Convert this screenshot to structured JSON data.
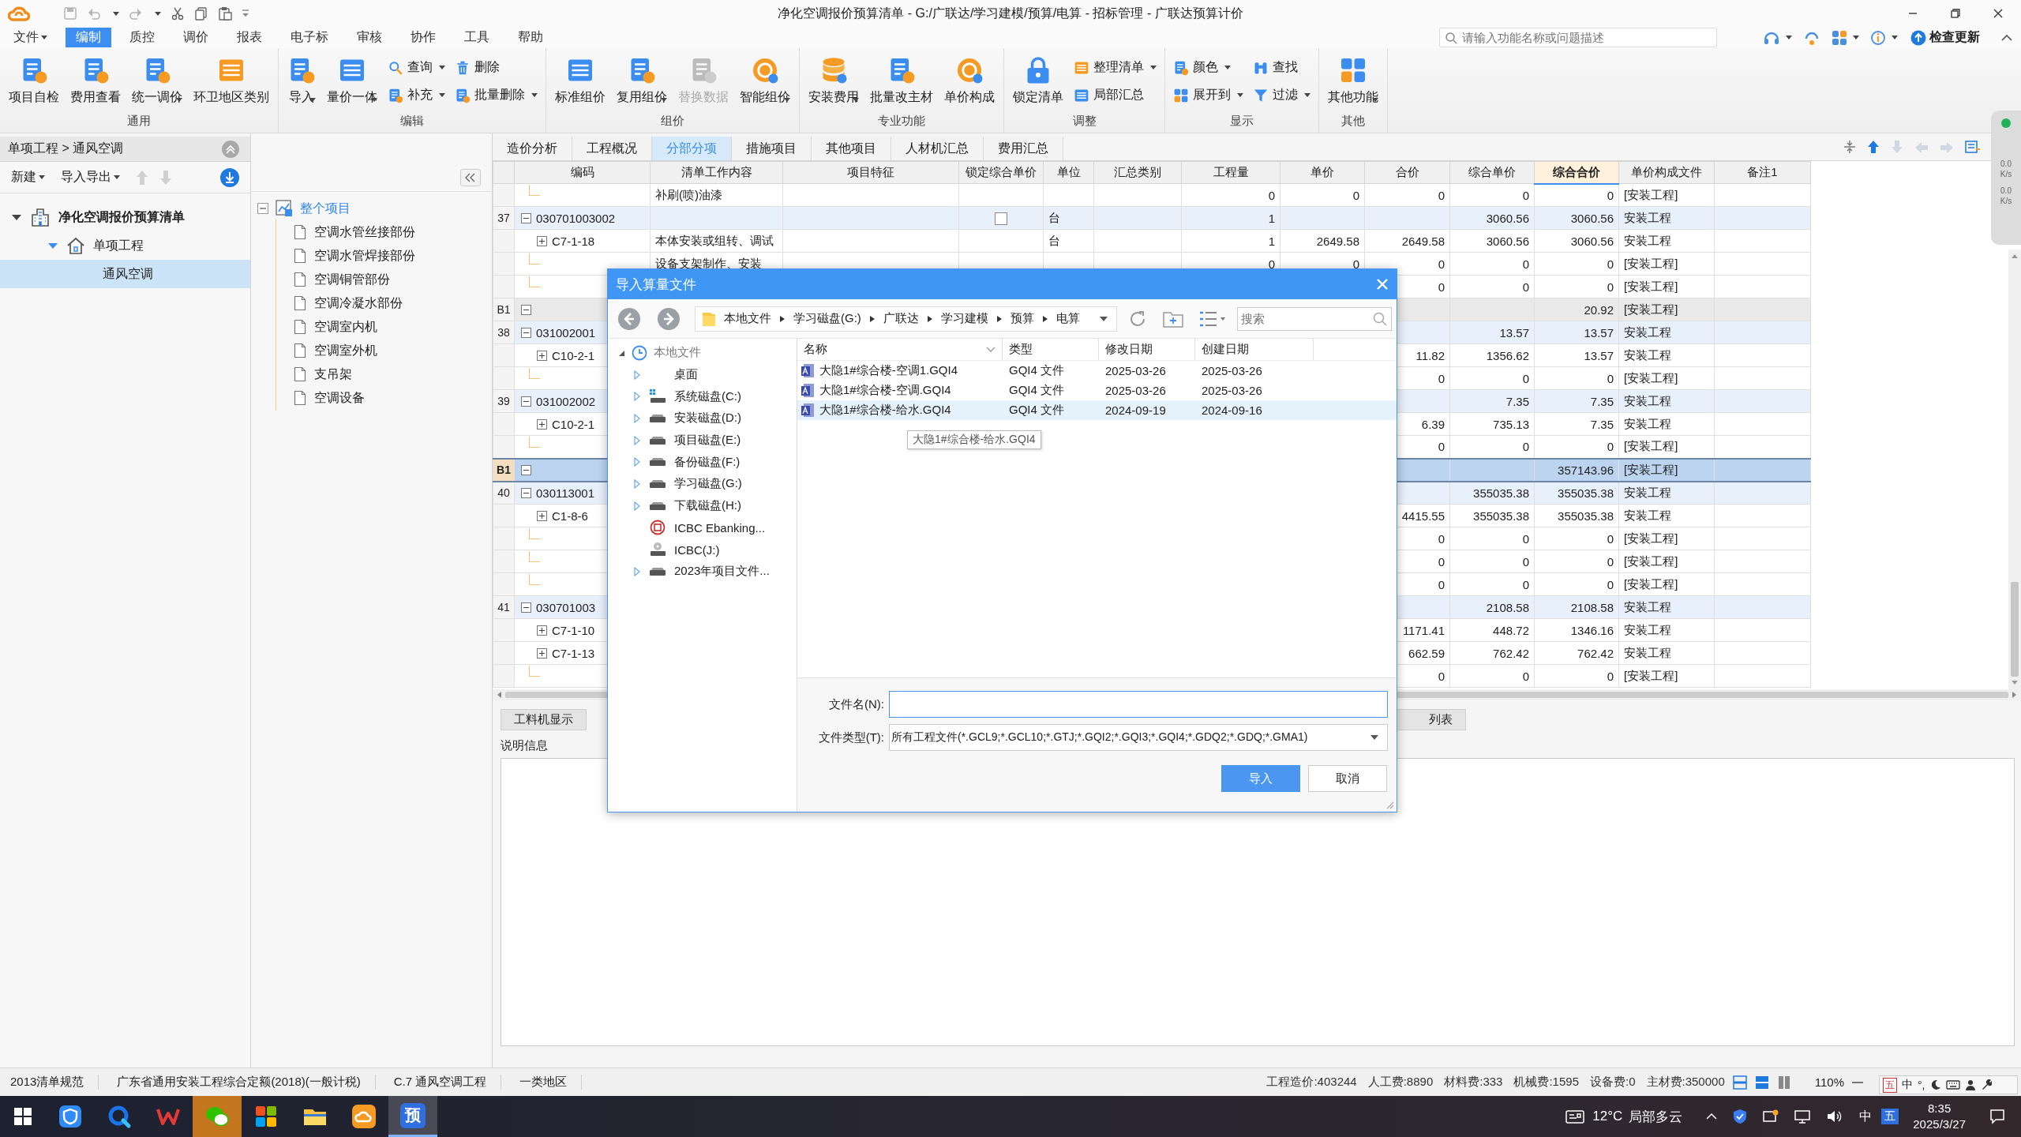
{
  "window": {
    "title": "净化空调报价预算清单 - G:/广联达/学习建模/预算/电算 - 招标管理 - 广联达预算计价"
  },
  "menu": [
    {
      "label": "文件",
      "selected": false,
      "dropdown": true
    },
    {
      "label": "编制",
      "selected": true,
      "dropdown": false
    },
    {
      "label": "质控",
      "selected": false,
      "dropdown": false
    },
    {
      "label": "调价",
      "selected": false,
      "dropdown": false
    },
    {
      "label": "报表",
      "selected": false,
      "dropdown": false
    },
    {
      "label": "电子标",
      "selected": false,
      "dropdown": false
    },
    {
      "label": "审核",
      "selected": false,
      "dropdown": false
    },
    {
      "label": "协作",
      "selected": false,
      "dropdown": false
    },
    {
      "label": "工具",
      "selected": false,
      "dropdown": false
    },
    {
      "label": "帮助",
      "selected": false,
      "dropdown": false
    }
  ],
  "search": {
    "placeholder": "请输入功能名称或问题描述"
  },
  "update_button": {
    "label": "检查更新"
  },
  "ribbon": [
    {
      "group": "通用",
      "buttons": [
        {
          "kind": "large",
          "label": "项目自检",
          "dropdown": false,
          "disabled": false
        },
        {
          "kind": "large",
          "label": "费用查看",
          "dropdown": false,
          "disabled": false
        },
        {
          "kind": "large",
          "label": "统一调价",
          "dropdown": true,
          "disabled": false
        },
        {
          "kind": "large",
          "label": "环卫地区类别",
          "dropdown": false,
          "disabled": false
        }
      ]
    },
    {
      "group": "编辑",
      "buttons": [
        {
          "kind": "large",
          "label": "导入",
          "dropdown": true,
          "disabled": false
        },
        {
          "kind": "large",
          "label": "量价一体",
          "dropdown": true,
          "disabled": false
        },
        {
          "kind": "small",
          "label": "查询",
          "dropdown": true,
          "disabled": false
        },
        {
          "kind": "small",
          "label": "补充",
          "dropdown": true,
          "disabled": false
        },
        {
          "kind": "small",
          "label": "删除",
          "dropdown": false,
          "disabled": false
        },
        {
          "kind": "small",
          "label": "批量删除",
          "dropdown": true,
          "disabled": false
        }
      ]
    },
    {
      "group": "组价",
      "buttons": [
        {
          "kind": "large",
          "label": "标准组价",
          "dropdown": false,
          "disabled": false
        },
        {
          "kind": "large",
          "label": "复用组价",
          "dropdown": true,
          "disabled": false
        },
        {
          "kind": "large",
          "label": "替换数据",
          "dropdown": false,
          "disabled": true
        },
        {
          "kind": "large",
          "label": "智能组价",
          "dropdown": true,
          "disabled": false
        }
      ]
    },
    {
      "group": "专业功能",
      "buttons": [
        {
          "kind": "large",
          "label": "安装费用",
          "dropdown": true,
          "disabled": false
        },
        {
          "kind": "large",
          "label": "批量改主材",
          "dropdown": false,
          "disabled": false
        },
        {
          "kind": "large",
          "label": "单价构成",
          "dropdown": false,
          "disabled": false
        }
      ]
    },
    {
      "group": "调整",
      "buttons": [
        {
          "kind": "large",
          "label": "锁定清单",
          "dropdown": false,
          "disabled": false
        },
        {
          "kind": "small",
          "label": "整理清单",
          "dropdown": true,
          "disabled": false
        },
        {
          "kind": "small",
          "label": "局部汇总",
          "dropdown": false,
          "disabled": false
        }
      ]
    },
    {
      "group": "显示",
      "buttons": [
        {
          "kind": "small",
          "label": "颜色",
          "dropdown": true,
          "disabled": false
        },
        {
          "kind": "small",
          "label": "展开到",
          "dropdown": true,
          "disabled": false
        },
        {
          "kind": "small",
          "label": "查找",
          "dropdown": false,
          "disabled": false
        },
        {
          "kind": "small",
          "label": "过滤",
          "dropdown": true,
          "disabled": false
        }
      ]
    },
    {
      "group": "其他",
      "buttons": [
        {
          "kind": "large",
          "label": "其他功能",
          "dropdown": true,
          "disabled": false
        }
      ]
    }
  ],
  "left_panel": {
    "breadcrumb": "单项工程 > 通风空调",
    "toolbar": [
      {
        "label": "新建",
        "dropdown": true
      },
      {
        "label": "导入导出",
        "dropdown": true
      }
    ],
    "tree": [
      {
        "label": "净化空调报价预算清单",
        "kind": "building",
        "expanded": true,
        "selected": false,
        "children": [
          {
            "label": "单项工程",
            "kind": "house",
            "expanded": true,
            "selected": false,
            "children": [
              {
                "label": "通风空调",
                "selected": true
              }
            ]
          }
        ]
      }
    ]
  },
  "section_tree": {
    "label": "整个项目",
    "expanded": true,
    "selected": true,
    "children": [
      {
        "label": "空调水管丝接部份",
        "selected": false
      },
      {
        "label": "空调水管焊接部份",
        "selected": false
      },
      {
        "label": "空调铜管部份",
        "selected": false
      },
      {
        "label": "空调冷凝水部份",
        "selected": false
      },
      {
        "label": "空调室内机",
        "selected": false
      },
      {
        "label": "空调室外机",
        "selected": false
      },
      {
        "label": "支吊架",
        "selected": false
      },
      {
        "label": "空调设备",
        "selected": false
      }
    ]
  },
  "tabs": [
    {
      "label": "造价分析",
      "selected": false
    },
    {
      "label": "工程概况",
      "selected": false
    },
    {
      "label": "分部分项",
      "selected": true
    },
    {
      "label": "措施项目",
      "selected": false
    },
    {
      "label": "其他项目",
      "selected": false
    },
    {
      "label": "人材机汇总",
      "selected": false
    },
    {
      "label": "费用汇总",
      "selected": false
    }
  ],
  "table": {
    "columns": [
      {
        "selected": false
      },
      {
        "label": "编码",
        "selected": false
      },
      {
        "label": "清单工作内容",
        "selected": false
      },
      {
        "label": "项目特征",
        "selected": false
      },
      {
        "label": "锁定综合单价",
        "selected": false
      },
      {
        "label": "单位",
        "selected": false
      },
      {
        "label": "汇总类别",
        "selected": false
      },
      {
        "label": "工程量",
        "selected": false
      },
      {
        "label": "单价",
        "selected": false
      },
      {
        "label": "合价",
        "selected": false
      },
      {
        "label": "综合单价",
        "selected": false
      },
      {
        "label": "综合合价",
        "selected": true
      },
      {
        "label": "单价构成文件",
        "selected": false
      },
      {
        "label": "备注1",
        "selected": false
      }
    ],
    "rows": [
      {
        "kind": "detail",
        "selected": false,
        "content": "补刷(喷)油漆",
        "qty": "0",
        "price": "0",
        "amount": "0",
        "unit_total": "0",
        "total": "0",
        "file": "[安装工程]"
      },
      {
        "kind": "item",
        "selected": false,
        "expanded": true,
        "no": "37",
        "code": "030701003002",
        "locked": false,
        "unit": "台",
        "qty": "1",
        "unit_total": "3060.56",
        "total": "3060.56",
        "file": "安装工程"
      },
      {
        "kind": "sub",
        "selected": false,
        "expanded": false,
        "code": "C7-1-18",
        "content": "本体安装或组转、调试",
        "unit": "台",
        "qty": "1",
        "price": "2649.58",
        "amount": "2649.58",
        "unit_total": "3060.56",
        "total": "3060.56",
        "file": "安装工程"
      },
      {
        "kind": "detail",
        "selected": false,
        "content": "设备支架制作、安装",
        "qty": "0",
        "price": "0",
        "amount": "0",
        "unit_total": "0",
        "total": "0",
        "file": "[安装工程]"
      },
      {
        "kind": "detail",
        "selected": false,
        "amount": "0",
        "unit_total": "0",
        "total": "0",
        "file": "[安装工程]"
      },
      {
        "kind": "section",
        "selected": false,
        "expanded": true,
        "no": "B1",
        "total": "20.92",
        "file": "[安装工程]"
      },
      {
        "kind": "item",
        "selected": false,
        "expanded": true,
        "no": "38",
        "code": "031002001",
        "unit_total": "13.57",
        "total": "13.57",
        "file": "安装工程"
      },
      {
        "kind": "sub",
        "selected": false,
        "expanded": false,
        "code": "C10-2-1",
        "amount": "11.82",
        "unit_total": "1356.62",
        "total": "13.57",
        "file": "安装工程"
      },
      {
        "kind": "detail",
        "selected": false,
        "amount": "0",
        "unit_total": "0",
        "total": "0",
        "file": "[安装工程]"
      },
      {
        "kind": "item",
        "selected": false,
        "expanded": true,
        "no": "39",
        "code": "031002002",
        "unit_total": "7.35",
        "total": "7.35",
        "file": "安装工程"
      },
      {
        "kind": "sub",
        "selected": false,
        "expanded": false,
        "code": "C10-2-1",
        "amount": "6.39",
        "unit_total": "735.13",
        "total": "7.35",
        "file": "安装工程"
      },
      {
        "kind": "detail",
        "selected": false,
        "amount": "0",
        "unit_total": "0",
        "total": "0",
        "file": "[安装工程]"
      },
      {
        "kind": "section",
        "selected": true,
        "expanded": true,
        "no": "B1",
        "total": "357143.96",
        "file": "[安装工程]"
      },
      {
        "kind": "item",
        "selected": false,
        "expanded": true,
        "no": "40",
        "code": "030113001",
        "unit_total": "355035.38",
        "total": "355035.38",
        "file": "安装工程"
      },
      {
        "kind": "sub",
        "selected": false,
        "expanded": false,
        "code": "C1-8-6",
        "amount": "4415.55",
        "unit_total": "355035.38",
        "total": "355035.38",
        "file": "安装工程"
      },
      {
        "kind": "detail",
        "selected": false,
        "amount": "0",
        "unit_total": "0",
        "total": "0",
        "file": "[安装工程]"
      },
      {
        "kind": "detail",
        "selected": false,
        "amount": "0",
        "unit_total": "0",
        "total": "0",
        "file": "[安装工程]"
      },
      {
        "kind": "detail",
        "selected": false,
        "amount": "0",
        "unit_total": "0",
        "total": "0",
        "file": "[安装工程]"
      },
      {
        "kind": "item",
        "selected": false,
        "expanded": true,
        "no": "41",
        "code": "030701003",
        "unit_total": "2108.58",
        "total": "2108.58",
        "file": "安装工程"
      },
      {
        "kind": "sub",
        "selected": false,
        "expanded": false,
        "code": "C7-1-10",
        "amount": "1171.41",
        "unit_total": "448.72",
        "total": "1346.16",
        "file": "安装工程"
      },
      {
        "kind": "sub",
        "selected": false,
        "expanded": false,
        "code": "C7-1-13",
        "amount": "662.59",
        "unit_total": "762.42",
        "total": "762.42",
        "file": "安装工程"
      },
      {
        "kind": "detail",
        "selected": false,
        "amount": "0",
        "unit_total": "0",
        "total": "0",
        "file": "[安装工程]"
      }
    ]
  },
  "bottom_panel": {
    "tabs": [
      {
        "label": "工料机显示",
        "selected": false
      },
      {
        "label": "列表",
        "selected": false
      }
    ],
    "description_label": "说明信息"
  },
  "dialog": {
    "title": "导入算量文件",
    "path": [
      "本地文件",
      "学习磁盘(G:)",
      "广联达",
      "学习建模",
      "预算",
      "电算"
    ],
    "search_placeholder": "搜索",
    "tree": {
      "label": "本地文件",
      "kind": "recent",
      "expanded": true,
      "children": [
        {
          "label": "桌面",
          "kind": "desktop",
          "expandable": true
        },
        {
          "label": "系统磁盘(C:)",
          "kind": "system",
          "expandable": true
        },
        {
          "label": "安装磁盘(D:)",
          "kind": "drive",
          "expandable": true
        },
        {
          "label": "项目磁盘(E:)",
          "kind": "drive",
          "expandable": true
        },
        {
          "label": "备份磁盘(F:)",
          "kind": "drive",
          "expandable": true
        },
        {
          "label": "学习磁盘(G:)",
          "kind": "drive",
          "expandable": true
        },
        {
          "label": "下载磁盘(H:)",
          "kind": "drive",
          "expandable": true
        },
        {
          "label": "ICBC Ebanking...",
          "kind": "bank",
          "expandable": false
        },
        {
          "label": "ICBC(J:)",
          "kind": "disc",
          "expandable": false
        },
        {
          "label": "2023年项目文件...",
          "kind": "drive",
          "expandable": true
        }
      ]
    },
    "columns": [
      {
        "label": "名称",
        "sorted": true
      },
      {
        "label": "类型",
        "sorted": false
      },
      {
        "label": "修改日期",
        "sorted": false
      },
      {
        "label": "创建日期",
        "sorted": false
      }
    ],
    "files": [
      {
        "name": "大隐1#综合楼-空调1.GQI4",
        "type": "GQI4 文件",
        "modified": "2025-03-26",
        "created": "2025-03-26",
        "selected": false
      },
      {
        "name": "大隐1#综合楼-空调.GQI4",
        "type": "GQI4 文件",
        "modified": "2025-03-26",
        "created": "2025-03-26",
        "selected": false
      },
      {
        "name": "大隐1#综合楼-给水.GQI4",
        "type": "GQI4 文件",
        "modified": "2024-09-19",
        "created": "2024-09-16",
        "selected": true
      }
    ],
    "tooltip": "大隐1#综合楼-给水.GQI4",
    "file_name": {
      "label": "文件名(N):"
    },
    "file_type": {
      "label": "文件类型(T):",
      "value": "所有工程文件(*.GCL9;*.GCL10;*.GTJ;*.GQI2;*.GQI3;*.GQI4;*.GDQ2;*.GDQ;*.GMA1)"
    },
    "buttons": [
      {
        "label": "导入",
        "kind": "primary"
      },
      {
        "label": "取消",
        "kind": "secondary"
      }
    ]
  },
  "net_widget": {
    "speeds": [
      {
        "value": "0.0",
        "unit": "K/s"
      },
      {
        "value": "0.0",
        "unit": "K/s"
      }
    ]
  },
  "status_bar": {
    "left": [
      "2013清单规范",
      "广东省通用安装工程综合定额(2018)(一般计税)",
      "C.7 通风空调工程",
      "一类地区"
    ],
    "totals": [
      "工程造价:403244",
      "人工费:8890",
      "材料费:333",
      "机械费:1595",
      "设备费:0",
      "主材费:350000"
    ],
    "zoom": "110%"
  },
  "ime_bar": {
    "labels": [
      "五",
      "中",
      "°,"
    ]
  },
  "taskbar": {
    "apps": [
      {
        "kind": "shield",
        "active": false,
        "attention": false
      },
      {
        "kind": "browser",
        "active": false,
        "attention": false
      },
      {
        "kind": "office",
        "active": false,
        "attention": false
      },
      {
        "kind": "chat",
        "active": false,
        "attention": true
      },
      {
        "kind": "store",
        "active": false,
        "attention": false
      },
      {
        "kind": "folder",
        "active": false,
        "attention": false
      },
      {
        "kind": "cloud",
        "active": false,
        "attention": false
      },
      {
        "kind": "label",
        "label": "预",
        "active": true,
        "attention": false
      }
    ],
    "weather": "12°C",
    "weather_text": "局部多云",
    "ime": "中",
    "ime_mode": "五",
    "time": "8:35",
    "date": "2025/3/27"
  }
}
